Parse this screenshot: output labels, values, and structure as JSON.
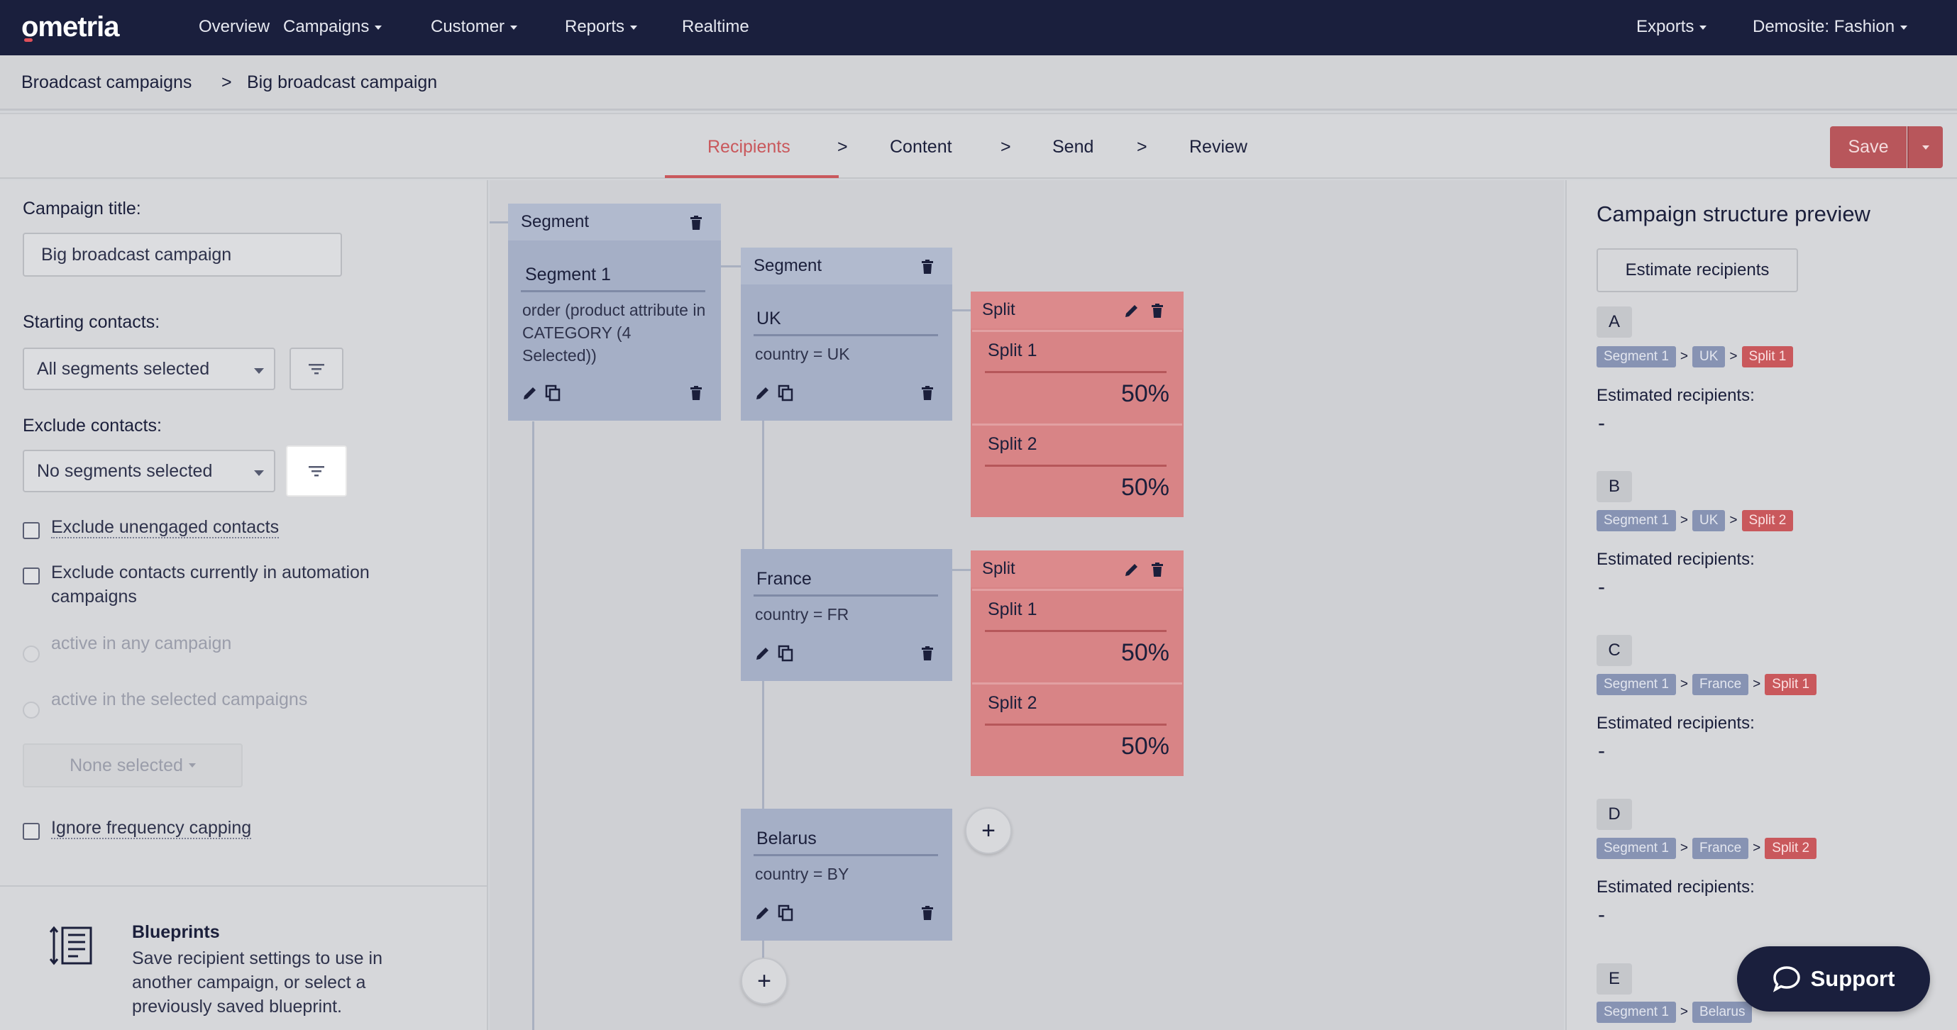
{
  "nav": {
    "logo": "ometria",
    "items": [
      "Overview",
      "Campaigns",
      "Customer",
      "Reports",
      "Realtime"
    ],
    "exports": "Exports",
    "site": "Demosite: Fashion"
  },
  "breadcrumb": {
    "parent": "Broadcast campaigns",
    "separator": ">",
    "current": "Big broadcast campaign"
  },
  "steps": {
    "items": [
      "Recipients",
      "Content",
      "Send",
      "Review"
    ],
    "separator": ">",
    "active": "Recipients"
  },
  "toolbar": {
    "save_label": "Save"
  },
  "left": {
    "title_label": "Campaign title:",
    "title_value": "Big broadcast campaign",
    "starting_label": "Starting contacts:",
    "starting_value": "All segments selected",
    "exclude_label": "Exclude contacts:",
    "exclude_value": "No segments selected",
    "exclude_unengaged": "Exclude unengaged contacts",
    "exclude_automation": "Exclude contacts currently in automation campaigns",
    "radio_any": "active in any campaign",
    "radio_selected": "active in the selected campaigns",
    "none_selected": "None selected",
    "ignore_capping": "Ignore frequency capping",
    "blueprints_title": "Blueprints",
    "blueprints_text": "Save recipient settings to use in another campaign, or select a previously saved blueprint."
  },
  "canvas": {
    "root_segment": {
      "header": "Segment",
      "title": "Segment 1",
      "rule": "order (product attribute in CATEGORY (4 Selected))"
    },
    "child_header": "Segment",
    "segments": [
      {
        "title": "UK",
        "rule": "country = UK"
      },
      {
        "title": "France",
        "rule": "country = FR"
      },
      {
        "title": "Belarus",
        "rule": "country = BY"
      }
    ],
    "split_header": "Split",
    "splits": [
      {
        "name": "Split 1",
        "percent": "50%"
      },
      {
        "name": "Split 2",
        "percent": "50%"
      }
    ],
    "add": "+"
  },
  "preview": {
    "title": "Campaign structure preview",
    "estimate_button": "Estimate recipients",
    "estimated_label": "Estimated recipients:",
    "estimated_value": "-",
    "variants": [
      {
        "label": "A",
        "path": [
          "Segment 1",
          "UK",
          "Split 1"
        ]
      },
      {
        "label": "B",
        "path": [
          "Segment 1",
          "UK",
          "Split 2"
        ]
      },
      {
        "label": "C",
        "path": [
          "Segment 1",
          "France",
          "Split 1"
        ]
      },
      {
        "label": "D",
        "path": [
          "Segment 1",
          "France",
          "Split 2"
        ]
      },
      {
        "label": "E",
        "path": [
          "Segment 1",
          "Belarus"
        ]
      }
    ]
  },
  "support": {
    "label": "Support"
  },
  "colors": {
    "navy": "#1a1f3d",
    "accent_red": "#c9585c",
    "segment_blue": "#a5afc6",
    "split_red": "#d88486"
  },
  "icons": [
    "pencil-icon",
    "copy-icon",
    "trash-icon",
    "filter-icon",
    "blueprint-icon",
    "chat-icon"
  ]
}
